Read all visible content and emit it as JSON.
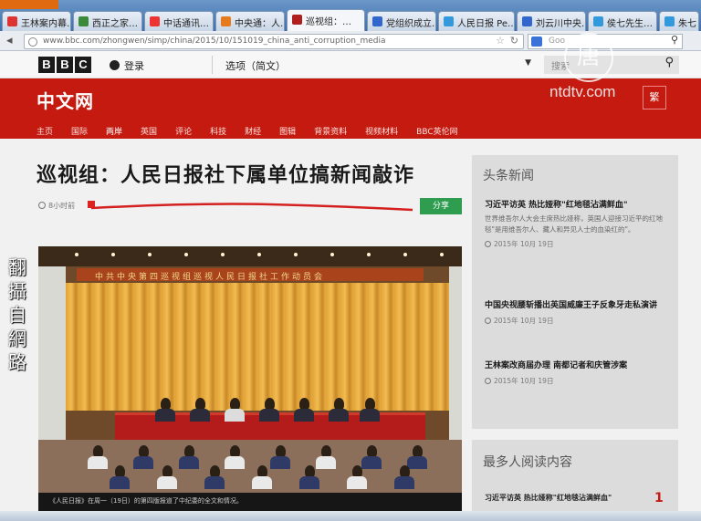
{
  "browser": {
    "tabs": [
      {
        "label": "王林案内幕…",
        "color": "#d33"
      },
      {
        "label": "西正之家…",
        "color": "#3a8a3a"
      },
      {
        "label": "中话通讯…",
        "color": "#e33"
      },
      {
        "label": "中央通：人…",
        "color": "#e87a1e"
      },
      {
        "label": "巡视组：…",
        "color": "#b01e1e"
      },
      {
        "label": "党组织成立…",
        "color": "#3366cc"
      },
      {
        "label": "人民日报 Pe…",
        "color": "#3399dd"
      },
      {
        "label": "刘云川中央…",
        "color": "#3366cc"
      },
      {
        "label": "侯七先生…",
        "color": "#3399dd"
      },
      {
        "label": "朱七",
        "color": "#3399dd"
      }
    ],
    "url": "www.bbc.com/zhongwen/simp/china/2015/10/151019_china_anti_corruption_media",
    "search_placeholder": "Goo"
  },
  "bbc": {
    "logo_letters": [
      "B",
      "B",
      "C"
    ],
    "signin_label": "登录",
    "language_label": "选项（简文）",
    "search_placeholder": "搜索"
  },
  "masthead": {
    "site_title": "中文网",
    "watermark": "ntdtv.com",
    "traditional_button": "繁",
    "nav": [
      "主页",
      "国际",
      "两岸",
      "英国",
      "评论",
      "科技",
      "财经",
      "图辑",
      "背景资料",
      "视频材料",
      "BBC英伦网"
    ],
    "active_nav_index": 2
  },
  "ntd_stamp": "唐",
  "article": {
    "headline": "巡视组：人民日报社下属单位搞新闻敲诈",
    "timestamp": "8小时前",
    "share_label": "分享",
    "photo_banner": "中共中央第四巡视组巡视人民日报社工作动员会",
    "photo_caption": "《人民日报》在周一（19日）的第四版报道了中纪委的全文和情况。"
  },
  "left_overlay": [
    "翻",
    "攝",
    "自",
    "網",
    "路"
  ],
  "sidebar": {
    "top_news_title": "头条新闻",
    "items": [
      {
        "title": "习近平访英 热比娅称\"红地毯沾满鲜血\"",
        "desc": "世界维吾尔人大会主席热比娅称，英国人迎接习近平的红地毯\"是用维吾尔人、藏人和异见人士的血染红的\"。",
        "date": "2015年 10月 19日"
      },
      {
        "title": "中国央视腰斩播出英国威廉王子反象牙走私演讲",
        "desc": "",
        "date": "2015年 10月 19日"
      },
      {
        "title": "王林案改商届办理 南都记者和庆管涉案",
        "desc": "",
        "date": "2015年 10月 19日"
      }
    ],
    "most_read_title": "最多人阅读内容",
    "most_read": [
      {
        "title": "习近平访英 热比娅称\"红地毯沾满鲜血\"",
        "rank": "1"
      }
    ]
  }
}
